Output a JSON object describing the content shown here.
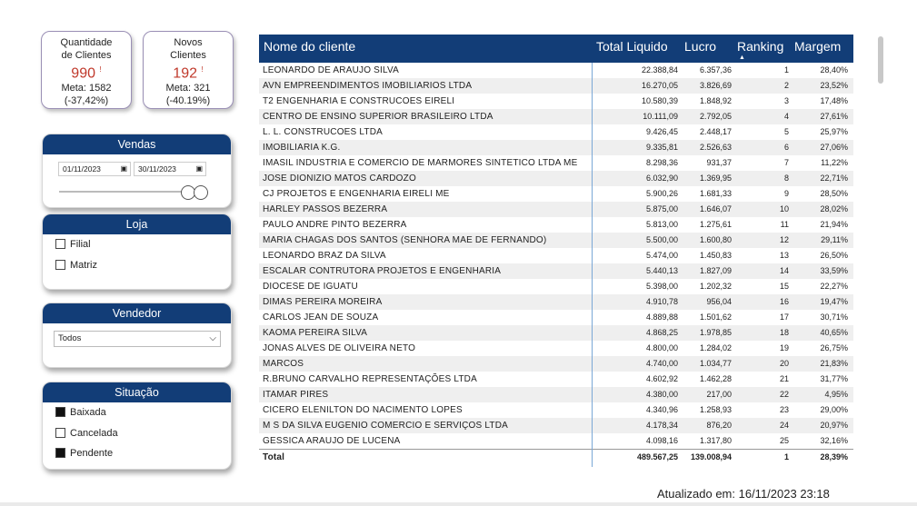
{
  "kpis": {
    "qtd": {
      "title_line1": "Quantidade",
      "title_line2": "de Clientes",
      "value": "990",
      "flag": "!",
      "meta": "Meta: 1582",
      "delta": "(-37,42%)"
    },
    "novos": {
      "title_line1": "Novos",
      "title_line2": "Clientes",
      "value": "192",
      "flag": "!",
      "meta": "Meta: 321",
      "delta": "(-40.19%)"
    }
  },
  "vendas": {
    "title": "Vendas",
    "date_start": "01/11/2023",
    "date_end": "30/11/2023"
  },
  "loja": {
    "title": "Loja",
    "options": [
      {
        "label": "Filial",
        "checked": false
      },
      {
        "label": "Matriz",
        "checked": false
      }
    ]
  },
  "vendedor": {
    "title": "Vendedor",
    "selected": "Todos"
  },
  "situacao": {
    "title": "Situação",
    "options": [
      {
        "label": "Baixada",
        "checked": true
      },
      {
        "label": "Cancelada",
        "checked": false
      },
      {
        "label": "Pendente",
        "checked": true
      }
    ]
  },
  "table": {
    "columns": [
      "Nome do cliente",
      "Total Liquido",
      "Lucro",
      "Ranking",
      "Margem"
    ],
    "rows": [
      [
        "LEONARDO DE ARAUJO SILVA",
        "22.388,84",
        "6.357,36",
        "1",
        "28,40%"
      ],
      [
        "AVN EMPREENDIMENTOS IMOBILIARIOS LTDA",
        "16.270,05",
        "3.826,69",
        "2",
        "23,52%"
      ],
      [
        "T2 ENGENHARIA E CONSTRUCOES EIRELI",
        "10.580,39",
        "1.848,92",
        "3",
        "17,48%"
      ],
      [
        "CENTRO DE ENSINO SUPERIOR BRASILEIRO LTDA",
        "10.111,09",
        "2.792,05",
        "4",
        "27,61%"
      ],
      [
        "L. L. CONSTRUCOES LTDA",
        "9.426,45",
        "2.448,17",
        "5",
        "25,97%"
      ],
      [
        "IMOBILIARIA K.G.",
        "9.335,81",
        "2.526,63",
        "6",
        "27,06%"
      ],
      [
        "IMASIL INDUSTRIA E COMERCIO DE MARMORES SINTETICO LTDA ME",
        "8.298,36",
        "931,37",
        "7",
        "11,22%"
      ],
      [
        "JOSE DIONIZIO MATOS CARDOZO",
        "6.032,90",
        "1.369,95",
        "8",
        "22,71%"
      ],
      [
        "CJ PROJETOS E ENGENHARIA EIRELI ME",
        "5.900,26",
        "1.681,33",
        "9",
        "28,50%"
      ],
      [
        "HARLEY PASSOS BEZERRA",
        "5.875,00",
        "1.646,07",
        "10",
        "28,02%"
      ],
      [
        "PAULO ANDRE PINTO BEZERRA",
        "5.813,00",
        "1.275,61",
        "11",
        "21,94%"
      ],
      [
        "MARIA CHAGAS DOS SANTOS (SENHORA MAE DE FERNANDO)",
        "5.500,00",
        "1.600,80",
        "12",
        "29,11%"
      ],
      [
        "LEONARDO BRAZ DA SILVA",
        "5.474,00",
        "1.450,83",
        "13",
        "26,50%"
      ],
      [
        "ESCALAR CONTRUTORA PROJETOS E ENGENHARIA",
        "5.440,13",
        "1.827,09",
        "14",
        "33,59%"
      ],
      [
        "DIOCESE DE IGUATU",
        "5.398,00",
        "1.202,32",
        "15",
        "22,27%"
      ],
      [
        "DIMAS PEREIRA MOREIRA",
        "4.910,78",
        "956,04",
        "16",
        "19,47%"
      ],
      [
        "CARLOS JEAN DE SOUZA",
        "4.889,88",
        "1.501,62",
        "17",
        "30,71%"
      ],
      [
        "KAOMA PEREIRA SILVA",
        "4.868,25",
        "1.978,85",
        "18",
        "40,65%"
      ],
      [
        "JONAS ALVES DE OLIVEIRA NETO",
        "4.800,00",
        "1.284,02",
        "19",
        "26,75%"
      ],
      [
        "MARCOS",
        "4.740,00",
        "1.034,77",
        "20",
        "21,83%"
      ],
      [
        "R.BRUNO CARVALHO REPRESENTAÇÕES LTDA",
        "4.602,92",
        "1.462,28",
        "21",
        "31,77%"
      ],
      [
        "ITAMAR PIRES",
        "4.380,00",
        "217,00",
        "22",
        "4,95%"
      ],
      [
        "CICERO ELENILTON DO NACIMENTO LOPES",
        "4.340,96",
        "1.258,93",
        "23",
        "29,00%"
      ],
      [
        "M S DA SILVA EUGENIO COMERCIO E SERVIÇOS LTDA",
        "4.178,34",
        "876,20",
        "24",
        "20,97%"
      ],
      [
        "GESSICA ARAUJO DE LUCENA",
        "4.098,16",
        "1.317,80",
        "25",
        "32,16%"
      ]
    ],
    "total": [
      "Total",
      "489.567,25",
      "139.008,94",
      "1",
      "28,39%"
    ]
  },
  "updated": "Atualizado em: 16/11/2023 23:18"
}
